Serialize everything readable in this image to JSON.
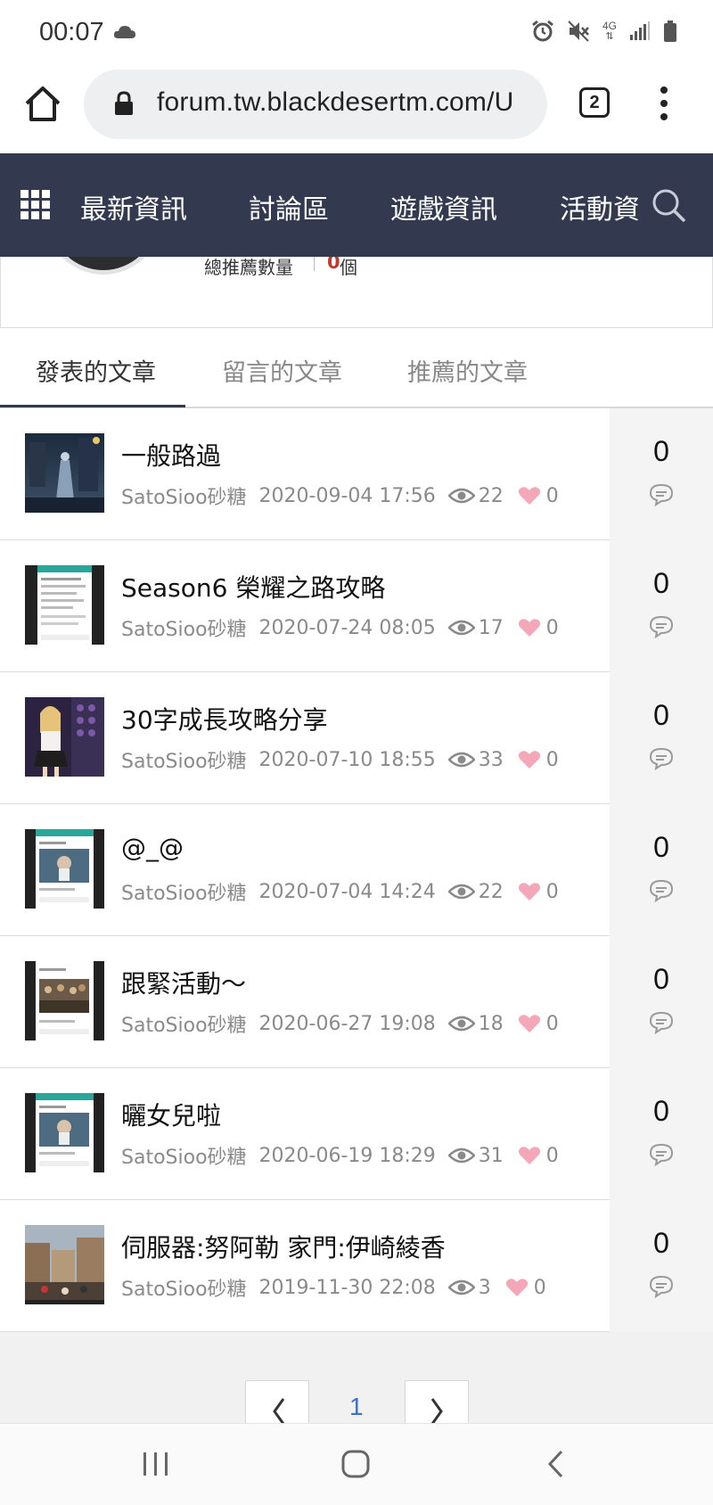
{
  "status_bar": {
    "time": "00:07",
    "network": "4G"
  },
  "browser": {
    "url": "forum.tw.blackdesertm.com/U",
    "tab_count": "2"
  },
  "site_nav": {
    "items": [
      "最新資訊",
      "討論區",
      "遊戲資訊",
      "活動資"
    ]
  },
  "profile": {
    "recommend_label": "總推薦數量",
    "recommend_count": "0",
    "recommend_unit": "個"
  },
  "tabs": [
    {
      "label": "發表的文章",
      "active": true
    },
    {
      "label": "留言的文章",
      "active": false
    },
    {
      "label": "推薦的文章",
      "active": false
    }
  ],
  "posts": [
    {
      "title": "一般路過",
      "author": "SatoSioo砂糖",
      "date": "2020-09-04 17:56",
      "views": "22",
      "likes": "0",
      "comments": "0",
      "thumb": "night-city"
    },
    {
      "title": "Season6 榮耀之路攻略",
      "author": "SatoSioo砂糖",
      "date": "2020-07-24 08:05",
      "views": "17",
      "likes": "0",
      "comments": "0",
      "thumb": "phone-doc"
    },
    {
      "title": "30字成長攻略分享",
      "author": "SatoSioo砂糖",
      "date": "2020-07-10 18:55",
      "views": "33",
      "likes": "0",
      "comments": "0",
      "thumb": "character"
    },
    {
      "title": "@_@",
      "author": "SatoSioo砂糖",
      "date": "2020-07-04 14:24",
      "views": "22",
      "likes": "0",
      "comments": "0",
      "thumb": "phone-image"
    },
    {
      "title": "跟緊活動～",
      "author": "SatoSioo砂糖",
      "date": "2020-06-27 19:08",
      "views": "18",
      "likes": "0",
      "comments": "0",
      "thumb": "phone-crowd"
    },
    {
      "title": "曬女兒啦",
      "author": "SatoSioo砂糖",
      "date": "2020-06-19 18:29",
      "views": "31",
      "likes": "0",
      "comments": "0",
      "thumb": "phone-image"
    },
    {
      "title": "伺服器:努阿勒 家門:伊崎綾香",
      "author": "SatoSioo砂糖",
      "date": "2019-11-30 22:08",
      "views": "3",
      "likes": "0",
      "comments": "0",
      "thumb": "town"
    }
  ],
  "pagination": {
    "current": "1",
    "prev_icon": "chevron-left-icon",
    "next_icon": "chevron-right-icon"
  },
  "colors": {
    "nav_bg": "#333a50",
    "accent_red": "#c0392b",
    "heart": "#f4a7b9",
    "page_link": "#3a6fd8"
  }
}
